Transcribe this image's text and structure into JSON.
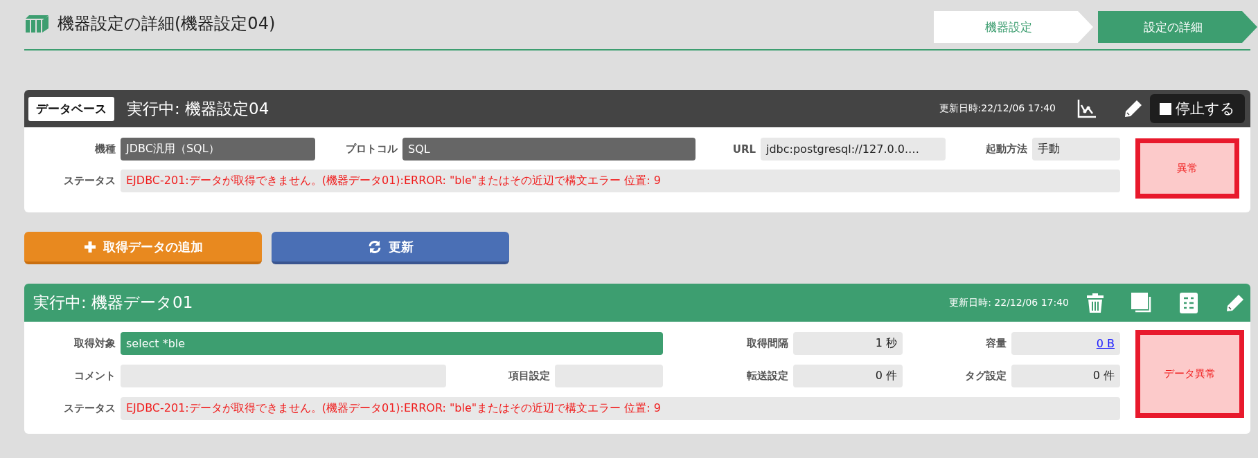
{
  "page": {
    "title": "機器設定の詳細(機器設定04)"
  },
  "breadcrumb": [
    {
      "label": "機器設定",
      "selected": false
    },
    {
      "label": "設定の詳細",
      "selected": true
    }
  ],
  "device_card": {
    "type_badge": "データベース",
    "title": "実行中: 機器設定04",
    "updated": "更新日時:22/12/06 17:40",
    "stop_button": "停止する",
    "fields": [
      {
        "label": "機種",
        "value": "JDBC汎用（SQL）",
        "kind": "dark"
      },
      {
        "label": "プロトコル",
        "value": "SQL",
        "kind": "dark"
      },
      {
        "label": "URL",
        "value": "jdbc:postgresql://127.0.0.…",
        "kind": "plain"
      },
      {
        "label": "起動方法",
        "value": "手動",
        "kind": "plain"
      },
      {
        "label": "ステータス",
        "value": "EJDBC-201:データが取得できません。(機器データ01):ERROR:  \"ble\"またはその近辺で構文エラー 位置: 9",
        "kind": "error"
      }
    ],
    "state_badge": "異常"
  },
  "buttons": [
    {
      "label": "取得データの追加",
      "kind": "add"
    },
    {
      "label": "更新",
      "kind": "refresh"
    }
  ],
  "data_card": {
    "title": "実行中: 機器データ01",
    "updated": "更新日時: 22/12/06 17:40",
    "fields": [
      {
        "label": "取得対象",
        "value": "select *ble",
        "kind": "highlight"
      },
      {
        "label": "取得間隔",
        "value": "1 秒",
        "kind": "number"
      },
      {
        "label": "容量",
        "value": "0 B",
        "kind": "link"
      },
      {
        "label": "コメント",
        "kind": "plain"
      },
      {
        "label": "項目設定",
        "kind": "plain"
      },
      {
        "label": "転送設定",
        "value": "0 件",
        "kind": "number"
      },
      {
        "label": "タグ設定",
        "value": "0 件",
        "kind": "number"
      },
      {
        "label": "ステータス",
        "value": "EJDBC-201:データが取得できません。(機器データ01):ERROR:  \"ble\"またはその近辺で構文エラー 位置: 9",
        "kind": "error"
      }
    ],
    "state_badge": "データ異常"
  }
}
